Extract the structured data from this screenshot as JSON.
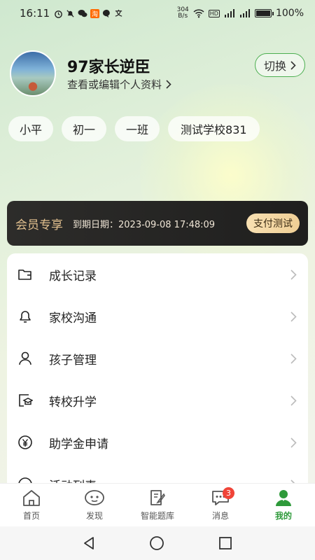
{
  "status_bar": {
    "time": "16:11",
    "net_speed_value": "304",
    "net_speed_unit": "B/s",
    "hd_label": "HD",
    "battery_percent": "100%"
  },
  "profile": {
    "name": "97家长逆臣",
    "edit_link": "查看或编辑个人资料",
    "switch_label": "切换",
    "chips": [
      "小平",
      "初一",
      "一班",
      "测试学校831"
    ]
  },
  "membership": {
    "title": "会员专享",
    "expiry": "到期日期：2023-09-08 17:48:09",
    "pay_button": "支付测试"
  },
  "menu": {
    "items": [
      {
        "label": "成长记录",
        "icon": "folder-icon"
      },
      {
        "label": "家校沟通",
        "icon": "bell-icon"
      },
      {
        "label": "孩子管理",
        "icon": "person-icon"
      },
      {
        "label": "转校升学",
        "icon": "school-transfer-icon"
      },
      {
        "label": "助学金申请",
        "icon": "yen-icon"
      },
      {
        "label": "活动列表",
        "icon": "smile-icon"
      }
    ]
  },
  "bottom_nav": {
    "items": [
      {
        "label": "首页",
        "icon": "home-icon"
      },
      {
        "label": "发现",
        "icon": "discover-icon"
      },
      {
        "label": "智能题库",
        "icon": "question-bank-icon"
      },
      {
        "label": "消息",
        "icon": "message-icon",
        "badge": "3"
      },
      {
        "label": "我的",
        "icon": "profile-icon",
        "active": true
      }
    ]
  },
  "colors": {
    "accent": "#2e9a3a",
    "member_gold": "#e2c08f",
    "badge_red": "#f04438"
  }
}
